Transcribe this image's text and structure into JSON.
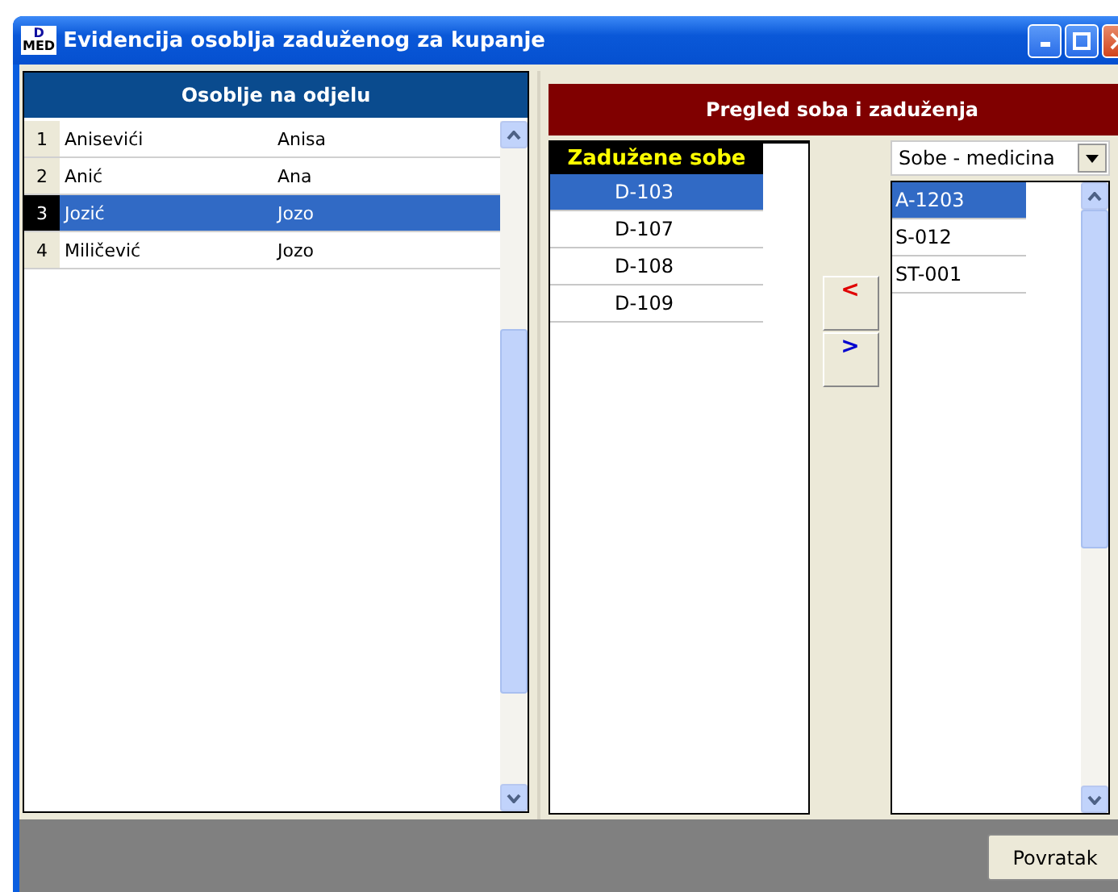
{
  "window": {
    "title": "Evidencija osoblja zaduženog za kupanje"
  },
  "logo": {
    "top": "D",
    "bottom": "MED"
  },
  "staff_panel": {
    "title": "Osoblje na odjelu",
    "rows": [
      {
        "index": "1",
        "surname": "Anisevići",
        "name": "Anisa",
        "selected": false
      },
      {
        "index": "2",
        "surname": "Anić",
        "name": "Ana",
        "selected": false
      },
      {
        "index": "3",
        "surname": "Jozić",
        "name": "Jozo",
        "selected": true
      },
      {
        "index": "4",
        "surname": "Miličević",
        "name": "Jozo",
        "selected": false
      }
    ]
  },
  "rooms_panel": {
    "title": "Pregled soba i zaduženja",
    "assigned": {
      "title": "Zadužene sobe",
      "rows": [
        {
          "label": "D-103",
          "selected": true
        },
        {
          "label": "D-107",
          "selected": false
        },
        {
          "label": "D-108",
          "selected": false
        },
        {
          "label": "D-109",
          "selected": false
        }
      ]
    },
    "move_buttons": [
      {
        "label": "<",
        "kind": "left"
      },
      {
        "label": ">",
        "kind": "right"
      }
    ],
    "category": {
      "value": "Sobe - medicina"
    },
    "available": {
      "rows": [
        {
          "label": "A-1203",
          "selected": true
        },
        {
          "label": "S-012",
          "selected": false
        },
        {
          "label": "ST-001",
          "selected": false
        }
      ]
    }
  },
  "buttons": [
    {
      "label": "Povratak"
    }
  ]
}
